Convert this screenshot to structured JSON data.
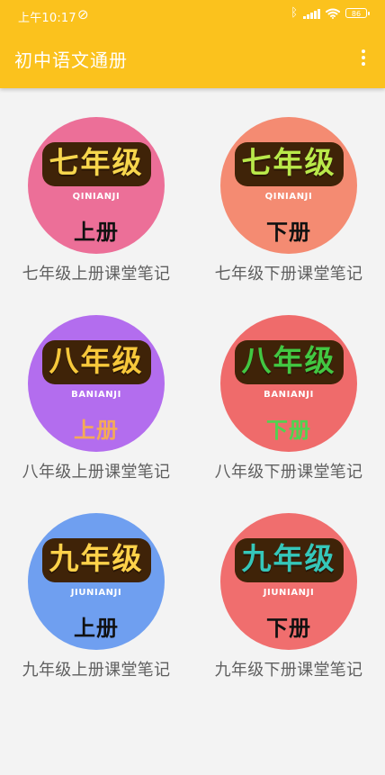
{
  "status": {
    "time": "上午10:17",
    "battery": "86"
  },
  "appbar": {
    "title": "初中语文通册"
  },
  "items": [
    {
      "grade": "七年级",
      "pinyin": "QINIANJI",
      "volume": "上册",
      "label": "七年级上册课堂笔记",
      "circle_color": "#ec6f98",
      "grade_color": "#f7d64d",
      "volume_color": "#111111"
    },
    {
      "grade": "七年级",
      "pinyin": "QINIANJI",
      "volume": "下册",
      "label": "七年级下册课堂笔记",
      "circle_color": "#f48b72",
      "grade_color": "#b9e94a",
      "volume_color": "#111111"
    },
    {
      "grade": "八年级",
      "pinyin": "BANIANJI",
      "volume": "上册",
      "label": "八年级上册课堂笔记",
      "circle_color": "#b36dee",
      "grade_color": "#f7c83b",
      "volume_color": "#f4aa57"
    },
    {
      "grade": "八年级",
      "pinyin": "BANIANJI",
      "volume": "下册",
      "label": "八年级下册课堂笔记",
      "circle_color": "#ef6b6b",
      "grade_color": "#42c742",
      "volume_color": "#4fd350"
    },
    {
      "grade": "九年级",
      "pinyin": "JIUNIANJI",
      "volume": "上册",
      "label": "九年级上册课堂笔记",
      "circle_color": "#6f9ff0",
      "grade_color": "#ffd24a",
      "volume_color": "#111111"
    },
    {
      "grade": "九年级",
      "pinyin": "JIUNIANJI",
      "volume": "下册",
      "label": "九年级下册课堂笔记",
      "circle_color": "#f06e6e",
      "grade_color": "#35c7ba",
      "volume_color": "#111111"
    }
  ]
}
